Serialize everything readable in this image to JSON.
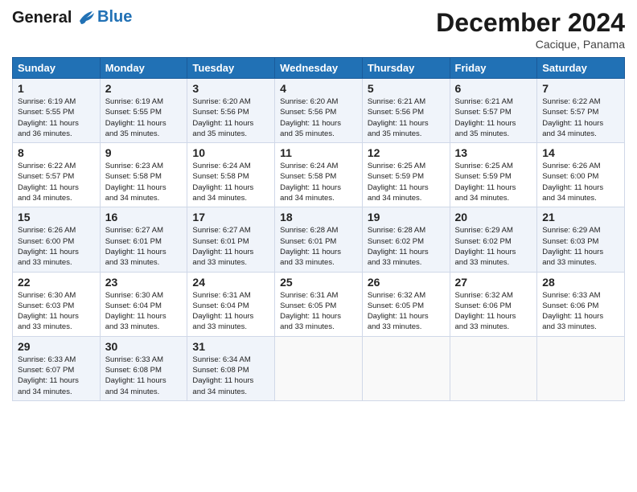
{
  "header": {
    "logo_line1": "General",
    "logo_line2": "Blue",
    "month": "December 2024",
    "location": "Cacique, Panama"
  },
  "weekdays": [
    "Sunday",
    "Monday",
    "Tuesday",
    "Wednesday",
    "Thursday",
    "Friday",
    "Saturday"
  ],
  "weeks": [
    [
      {
        "day": "1",
        "info": "Sunrise: 6:19 AM\nSunset: 5:55 PM\nDaylight: 11 hours\nand 36 minutes."
      },
      {
        "day": "2",
        "info": "Sunrise: 6:19 AM\nSunset: 5:55 PM\nDaylight: 11 hours\nand 35 minutes."
      },
      {
        "day": "3",
        "info": "Sunrise: 6:20 AM\nSunset: 5:56 PM\nDaylight: 11 hours\nand 35 minutes."
      },
      {
        "day": "4",
        "info": "Sunrise: 6:20 AM\nSunset: 5:56 PM\nDaylight: 11 hours\nand 35 minutes."
      },
      {
        "day": "5",
        "info": "Sunrise: 6:21 AM\nSunset: 5:56 PM\nDaylight: 11 hours\nand 35 minutes."
      },
      {
        "day": "6",
        "info": "Sunrise: 6:21 AM\nSunset: 5:57 PM\nDaylight: 11 hours\nand 35 minutes."
      },
      {
        "day": "7",
        "info": "Sunrise: 6:22 AM\nSunset: 5:57 PM\nDaylight: 11 hours\nand 34 minutes."
      }
    ],
    [
      {
        "day": "8",
        "info": "Sunrise: 6:22 AM\nSunset: 5:57 PM\nDaylight: 11 hours\nand 34 minutes."
      },
      {
        "day": "9",
        "info": "Sunrise: 6:23 AM\nSunset: 5:58 PM\nDaylight: 11 hours\nand 34 minutes."
      },
      {
        "day": "10",
        "info": "Sunrise: 6:24 AM\nSunset: 5:58 PM\nDaylight: 11 hours\nand 34 minutes."
      },
      {
        "day": "11",
        "info": "Sunrise: 6:24 AM\nSunset: 5:58 PM\nDaylight: 11 hours\nand 34 minutes."
      },
      {
        "day": "12",
        "info": "Sunrise: 6:25 AM\nSunset: 5:59 PM\nDaylight: 11 hours\nand 34 minutes."
      },
      {
        "day": "13",
        "info": "Sunrise: 6:25 AM\nSunset: 5:59 PM\nDaylight: 11 hours\nand 34 minutes."
      },
      {
        "day": "14",
        "info": "Sunrise: 6:26 AM\nSunset: 6:00 PM\nDaylight: 11 hours\nand 34 minutes."
      }
    ],
    [
      {
        "day": "15",
        "info": "Sunrise: 6:26 AM\nSunset: 6:00 PM\nDaylight: 11 hours\nand 33 minutes."
      },
      {
        "day": "16",
        "info": "Sunrise: 6:27 AM\nSunset: 6:01 PM\nDaylight: 11 hours\nand 33 minutes."
      },
      {
        "day": "17",
        "info": "Sunrise: 6:27 AM\nSunset: 6:01 PM\nDaylight: 11 hours\nand 33 minutes."
      },
      {
        "day": "18",
        "info": "Sunrise: 6:28 AM\nSunset: 6:01 PM\nDaylight: 11 hours\nand 33 minutes."
      },
      {
        "day": "19",
        "info": "Sunrise: 6:28 AM\nSunset: 6:02 PM\nDaylight: 11 hours\nand 33 minutes."
      },
      {
        "day": "20",
        "info": "Sunrise: 6:29 AM\nSunset: 6:02 PM\nDaylight: 11 hours\nand 33 minutes."
      },
      {
        "day": "21",
        "info": "Sunrise: 6:29 AM\nSunset: 6:03 PM\nDaylight: 11 hours\nand 33 minutes."
      }
    ],
    [
      {
        "day": "22",
        "info": "Sunrise: 6:30 AM\nSunset: 6:03 PM\nDaylight: 11 hours\nand 33 minutes."
      },
      {
        "day": "23",
        "info": "Sunrise: 6:30 AM\nSunset: 6:04 PM\nDaylight: 11 hours\nand 33 minutes."
      },
      {
        "day": "24",
        "info": "Sunrise: 6:31 AM\nSunset: 6:04 PM\nDaylight: 11 hours\nand 33 minutes."
      },
      {
        "day": "25",
        "info": "Sunrise: 6:31 AM\nSunset: 6:05 PM\nDaylight: 11 hours\nand 33 minutes."
      },
      {
        "day": "26",
        "info": "Sunrise: 6:32 AM\nSunset: 6:05 PM\nDaylight: 11 hours\nand 33 minutes."
      },
      {
        "day": "27",
        "info": "Sunrise: 6:32 AM\nSunset: 6:06 PM\nDaylight: 11 hours\nand 33 minutes."
      },
      {
        "day": "28",
        "info": "Sunrise: 6:33 AM\nSunset: 6:06 PM\nDaylight: 11 hours\nand 33 minutes."
      }
    ],
    [
      {
        "day": "29",
        "info": "Sunrise: 6:33 AM\nSunset: 6:07 PM\nDaylight: 11 hours\nand 34 minutes."
      },
      {
        "day": "30",
        "info": "Sunrise: 6:33 AM\nSunset: 6:08 PM\nDaylight: 11 hours\nand 34 minutes."
      },
      {
        "day": "31",
        "info": "Sunrise: 6:34 AM\nSunset: 6:08 PM\nDaylight: 11 hours\nand 34 minutes."
      },
      null,
      null,
      null,
      null
    ]
  ]
}
